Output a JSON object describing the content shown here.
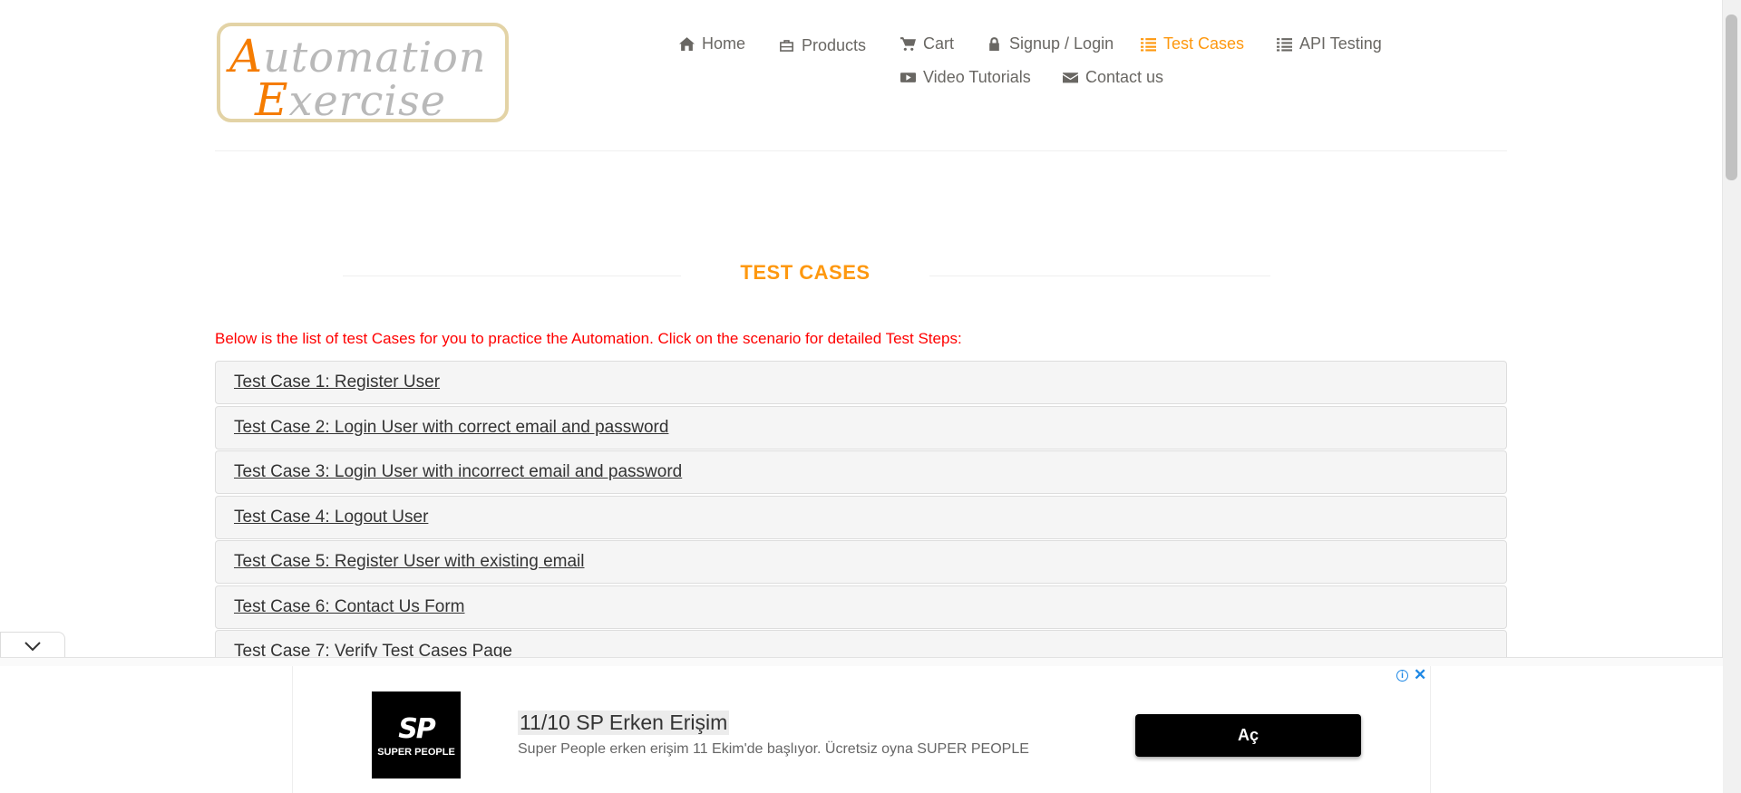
{
  "logo": {
    "line1_cap": "A",
    "line1_rest": "utomation",
    "line2_cap": "E",
    "line2_rest": "xercise"
  },
  "nav": {
    "items": [
      {
        "label": "Home",
        "icon": "home-icon"
      },
      {
        "label": "Products",
        "icon": "briefcase-icon"
      },
      {
        "label": "Cart",
        "icon": "cart-icon"
      },
      {
        "label": "Signup / Login",
        "icon": "lock-icon"
      },
      {
        "label": "Test Cases",
        "icon": "list-icon",
        "active": true
      },
      {
        "label": "API Testing",
        "icon": "list-icon"
      },
      {
        "label": "Video Tutorials",
        "icon": "youtube-icon"
      },
      {
        "label": "Contact us",
        "icon": "envelope-icon"
      }
    ]
  },
  "section_title": "TEST CASES",
  "intro": "Below is the list of test Cases for you to practice the Automation. Click on the scenario for detailed Test Steps:",
  "test_cases": [
    "Test Case 1: Register User",
    "Test Case 2: Login User with correct email and password",
    "Test Case 3: Login User with incorrect email and password",
    "Test Case 4: Logout User",
    "Test Case 5: Register User with existing email",
    "Test Case 6: Contact Us Form",
    "Test Case 7: Verify Test Cases Page"
  ],
  "ad": {
    "logo_mark": "SP",
    "logo_brand": "SUPER PEOPLE",
    "title": "11/10 SP Erken Erişim",
    "description": "Super People erken erişim 11 Ekim'de başlıyor. Ücretsiz oyna SUPER PEOPLE",
    "cta": "Aç",
    "info_icon": "i",
    "close_icon": "✕"
  },
  "colors": {
    "accent": "#fe980f",
    "intro_text": "#ff0000",
    "nav_text": "#696763"
  }
}
